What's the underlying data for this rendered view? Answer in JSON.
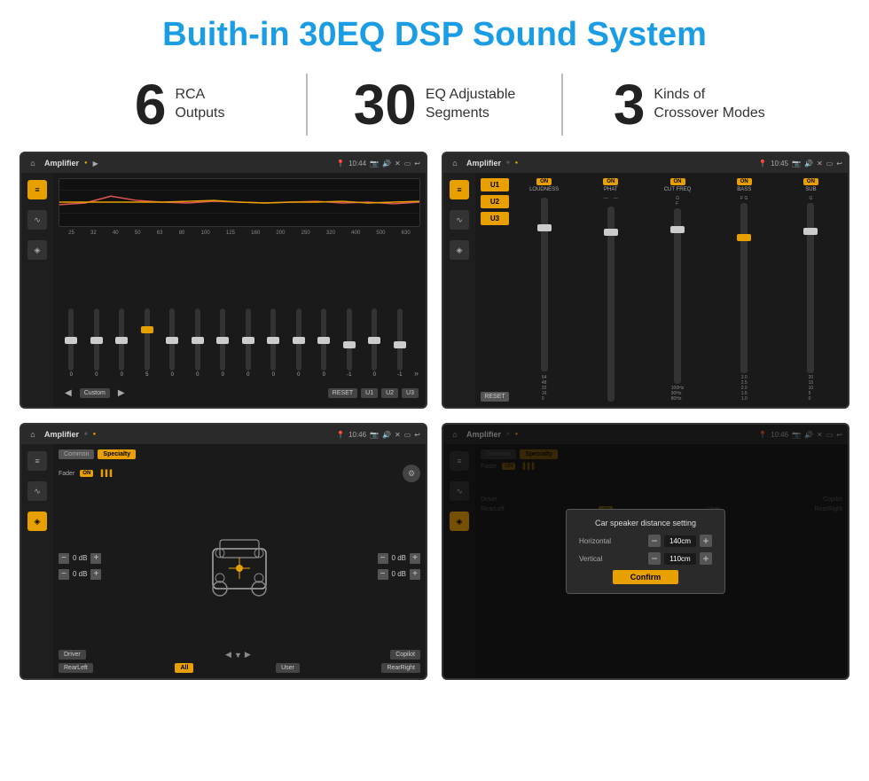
{
  "header": {
    "title": "Buith-in 30EQ DSP Sound System"
  },
  "stats": [
    {
      "number": "6",
      "desc_line1": "RCA",
      "desc_line2": "Outputs"
    },
    {
      "number": "30",
      "desc_line1": "EQ Adjustable",
      "desc_line2": "Segments"
    },
    {
      "number": "3",
      "desc_line1": "Kinds of",
      "desc_line2": "Crossover Modes"
    }
  ],
  "screens": {
    "eq_screen": {
      "topbar_title": "Amplifier",
      "time": "10:44",
      "freqs": [
        "25",
        "32",
        "40",
        "50",
        "63",
        "80",
        "100",
        "125",
        "160",
        "200",
        "250",
        "320",
        "400",
        "500",
        "630"
      ],
      "values": [
        "0",
        "0",
        "0",
        "5",
        "0",
        "0",
        "0",
        "0",
        "0",
        "0",
        "0",
        "-1",
        "0",
        "-1"
      ],
      "preset": "Custom",
      "buttons": [
        "RESET",
        "U1",
        "U2",
        "U3"
      ]
    },
    "amp_screen": {
      "topbar_title": "Amplifier",
      "time": "10:45",
      "u_buttons": [
        "U1",
        "U2",
        "U3"
      ],
      "channels": [
        "LOUDNESS",
        "PHAT",
        "CUT FREQ",
        "BASS",
        "SUB"
      ],
      "reset_label": "RESET"
    },
    "fader_screen": {
      "topbar_title": "Amplifier",
      "time": "10:46",
      "tabs": [
        "Common",
        "Specialty"
      ],
      "fader_label": "Fader",
      "fader_on": "ON",
      "db_values": [
        "0 dB",
        "0 dB",
        "0 dB",
        "0 dB"
      ],
      "bottom_buttons": [
        "Driver",
        "RearLeft",
        "All",
        "User",
        "RearRight",
        "Copilot"
      ]
    },
    "dialog_screen": {
      "topbar_title": "Amplifier",
      "time": "10:46",
      "tabs": [
        "Common",
        "Specialty"
      ],
      "dialog": {
        "title": "Car speaker distance setting",
        "horizontal_label": "Horizontal",
        "horizontal_value": "140cm",
        "vertical_label": "Vertical",
        "vertical_value": "110cm",
        "confirm_label": "Confirm"
      },
      "bottom_buttons": [
        "Driver",
        "RearLeft",
        "All",
        "User",
        "RearRight",
        "Copilot"
      ]
    }
  },
  "icons": {
    "home": "⌂",
    "back": "↩",
    "volume": "🔊",
    "location": "📍",
    "eq_icon": "≡",
    "wave_icon": "∿",
    "speaker_icon": "◈"
  }
}
